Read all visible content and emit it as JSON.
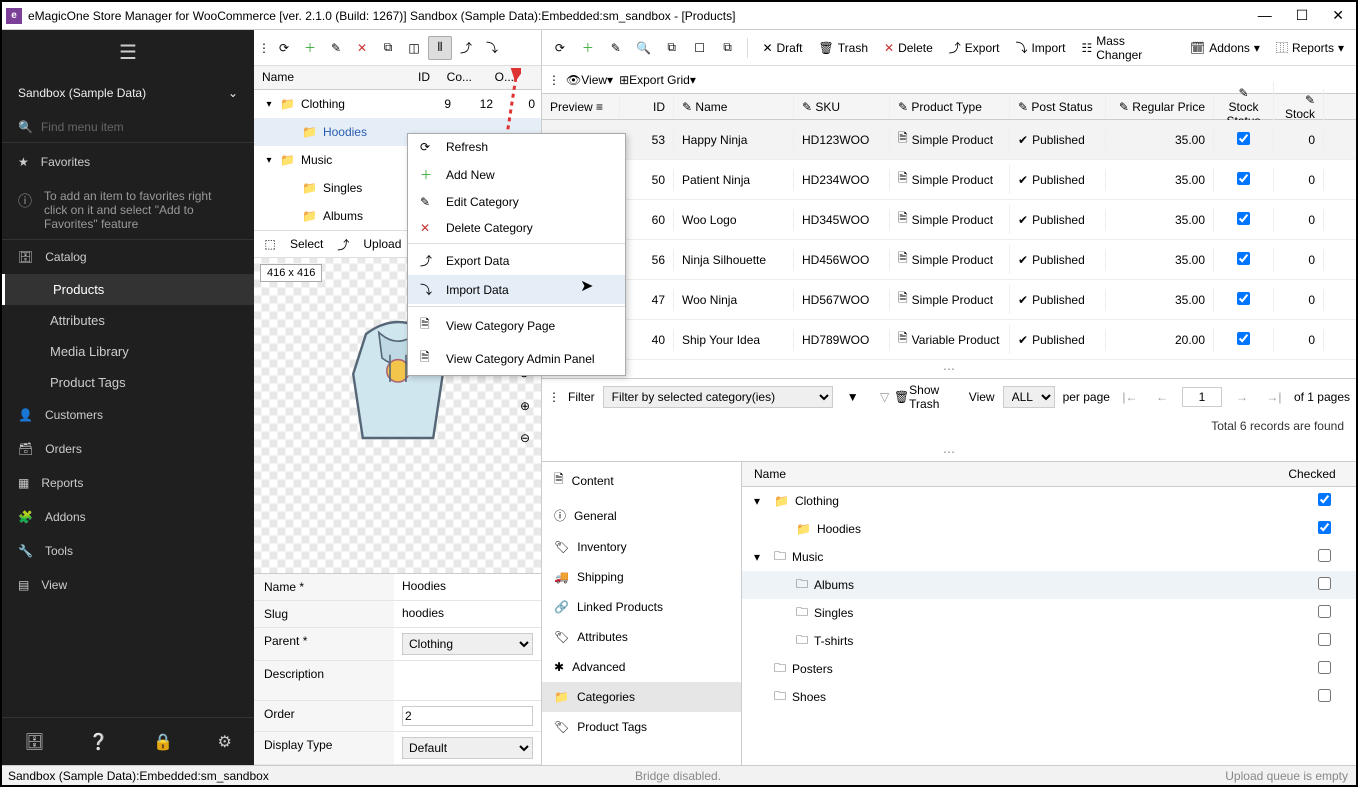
{
  "titlebar": {
    "text": "eMagicOne Store Manager for WooCommerce [ver. 2.1.0 (Build: 1267)] Sandbox (Sample Data):Embedded:sm_sandbox - [Products]"
  },
  "sidebar": {
    "db": "Sandbox (Sample Data)",
    "search_placeholder": "Find menu item",
    "fav": "Favorites",
    "favtip": "To add an item to favorites right click on it and select \"Add to Favorites\" feature",
    "items": [
      "Catalog",
      "Customers",
      "Orders",
      "Reports",
      "Addons",
      "Tools",
      "View"
    ],
    "subs": [
      "Products",
      "Attributes",
      "Media Library",
      "Product Tags"
    ]
  },
  "cat_cols": {
    "name": "Name",
    "id": "ID",
    "co": "Co...",
    "o": "O..."
  },
  "cat_tree": [
    {
      "exp": "▾",
      "depth": 0,
      "name": "Clothing",
      "id": "9",
      "co": "12",
      "o": "0"
    },
    {
      "exp": "",
      "depth": 1,
      "name": "Hoodies",
      "sel": true
    },
    {
      "exp": "▾",
      "depth": 0,
      "name": "Music"
    },
    {
      "exp": "",
      "depth": 1,
      "name": "Singles"
    },
    {
      "exp": "",
      "depth": 1,
      "name": "Albums"
    }
  ],
  "actions": {
    "select": "Select",
    "upload": "Upload"
  },
  "preview_badge": "416 x 416",
  "form": {
    "name_l": "Name *",
    "name_v": "Hoodies",
    "slug_l": "Slug",
    "slug_v": "hoodies",
    "parent_l": "Parent *",
    "parent_v": "Clothing",
    "desc_l": "Description",
    "desc_v": "",
    "order_l": "Order",
    "order_v": "2",
    "disp_l": "Display Type",
    "disp_v": "Default"
  },
  "toptb": {
    "draft": "Draft",
    "trash": "Trash",
    "delete": "Delete",
    "export": "Export",
    "import": "Import",
    "mass": "Mass Changer",
    "addons": "Addons",
    "reports": "Reports"
  },
  "viewtb": {
    "view": "View",
    "exportgrid": "Export Grid"
  },
  "gridcols": {
    "preview": "Preview",
    "id": "ID",
    "name": "Name",
    "sku": "SKU",
    "ptype": "Product Type",
    "post": "Post Status",
    "price": "Regular Price",
    "ss": "Stock Status",
    "stock": "Stock"
  },
  "rows": [
    {
      "id": "53",
      "name": "Happy Ninja",
      "sku": "HD123WOO",
      "ptype": "Simple Product",
      "status": "Published",
      "price": "35.00",
      "stock": "0",
      "sel": true
    },
    {
      "id": "50",
      "name": "Patient Ninja",
      "sku": "HD234WOO",
      "ptype": "Simple Product",
      "status": "Published",
      "price": "35.00",
      "stock": "0"
    },
    {
      "id": "60",
      "name": "Woo Logo",
      "sku": "HD345WOO",
      "ptype": "Simple Product",
      "status": "Published",
      "price": "35.00",
      "stock": "0"
    },
    {
      "id": "56",
      "name": "Ninja Silhouette",
      "sku": "HD456WOO",
      "ptype": "Simple Product",
      "status": "Published",
      "price": "35.00",
      "stock": "0"
    },
    {
      "id": "47",
      "name": "Woo Ninja",
      "sku": "HD567WOO",
      "ptype": "Simple Product",
      "status": "Published",
      "price": "35.00",
      "stock": "0"
    },
    {
      "id": "40",
      "name": "Ship Your Idea",
      "sku": "HD789WOO",
      "ptype": "Variable Product",
      "status": "Published",
      "price": "20.00",
      "stock": "0"
    }
  ],
  "filter": {
    "label": "Filter",
    "dd": "Filter by selected category(ies)",
    "show_trash": "Show Trash",
    "view": "View",
    "all": "ALL",
    "perpage": "per page",
    "page": "1",
    "ofpages": "of 1 pages",
    "totals": "Total 6 records are found"
  },
  "tabs": [
    "Content",
    "General",
    "Inventory",
    "Shipping",
    "Linked Products",
    "Attributes",
    "Advanced",
    "Categories",
    "Product Tags"
  ],
  "tabs_active": 7,
  "cattree_head": {
    "name": "Name",
    "checked": "Checked"
  },
  "cattree": [
    {
      "exp": "▾",
      "depth": 0,
      "name": "Clothing",
      "checked": true,
      "solid": true
    },
    {
      "exp": "",
      "depth": 1,
      "name": "Hoodies",
      "checked": true,
      "solid": true
    },
    {
      "exp": "▾",
      "depth": 0,
      "name": "Music",
      "checked": false,
      "solid": false
    },
    {
      "exp": "",
      "depth": 1,
      "name": "Albums",
      "checked": false,
      "solid": false,
      "hover": true
    },
    {
      "exp": "",
      "depth": 1,
      "name": "Singles",
      "checked": false,
      "solid": false
    },
    {
      "exp": "",
      "depth": 1,
      "name": "T-shirts",
      "checked": false,
      "solid": false
    },
    {
      "exp": "",
      "depth": 0,
      "name": "Posters",
      "checked": false,
      "solid": false
    },
    {
      "exp": "",
      "depth": 0,
      "name": "Shoes",
      "checked": false,
      "solid": false
    }
  ],
  "ctx": [
    "Refresh",
    "Add New",
    "Edit Category",
    "Delete Category",
    "Export Data",
    "Import Data",
    "View Category Page",
    "View Category Admin Panel"
  ],
  "ctx_hl": 5,
  "status": {
    "s1": "Sandbox (Sample Data):Embedded:sm_sandbox",
    "s2": "Bridge disabled.",
    "s3": "Upload queue is empty"
  }
}
